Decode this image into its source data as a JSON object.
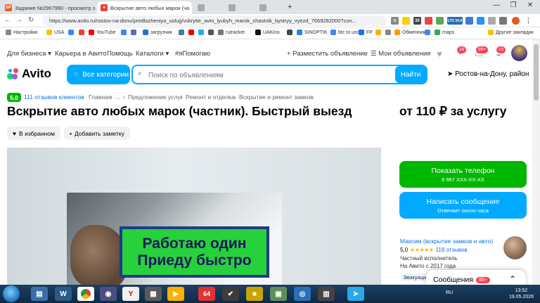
{
  "browser": {
    "tabs": [
      {
        "label": "Задание №2967990 - просмотр з",
        "icon": "sp-icon"
      },
      {
        "label": "Вскрытие авто любых марок (ча",
        "icon": "avito-icon"
      },
      {
        "label": "",
        "icon": "tab-icon"
      },
      {
        "label": "",
        "icon": "tab-icon"
      },
      {
        "label": "",
        "icon": "tab-icon"
      }
    ],
    "url": "https://www.avito.ru/rostov-na-donu/predlozheniya_uslug/vskrytie_avto_lyubyh_marok_chastnik_bystryy_vyezd_7669282000?con...",
    "bookmarks": [
      "Настройки",
      "USA",
      "YouTube",
      "загрузчик",
      "rutracker",
      "UAKino",
      "SINOPTIK",
      "btc to usd",
      "FP",
      "Обменник",
      "maps",
      "Другие закладки"
    ],
    "badges": {
      "ext1": "30",
      "ltc": "LTC 54.0"
    }
  },
  "header": {
    "links": [
      "Для бизнеса",
      "Карьера в Авито",
      "Помощь",
      "Каталоги",
      "#яПомогаю"
    ],
    "post_ad": "+ Разместить объявление",
    "my_ads": "Мои объявления",
    "badges": [
      "16",
      "99+",
      "16"
    ],
    "logo": "Avito",
    "categories_button": "Все категории",
    "search_placeholder": "Поиск по объявлениям",
    "search_button": "Найти",
    "location": "Ростов-на-Дону, район"
  },
  "listing": {
    "rating": "5,0",
    "reviews_link": "111 отзывов клиентов",
    "breadcrumbs": [
      "Главная",
      "...",
      "Предложение услуг",
      "Ремонт и отделка",
      "Вскрытие и ремонт замков"
    ],
    "title": "Вскрытие авто любых марок (частник). Быстрый выезд",
    "price": "от 110 ₽ за услугу",
    "favorite_label": "В избранном",
    "note_label": "Добавить заметку",
    "photo_sign_lines": [
      "Работаю один",
      "Приеду быстро"
    ]
  },
  "contact": {
    "phone_button": "Показать телефон",
    "phone_masked": "8 967 XXX-XX-XX",
    "message_button": "Написать сообщение",
    "message_sub": "Отвечает около часа"
  },
  "seller": {
    "name": "Максим (вскрытие замков и авто)",
    "rating": "5,0",
    "stars": "★★★★★",
    "reviews": "118 отзывов",
    "type": "Частный исполнитель",
    "since": "На Авито с 2017 года",
    "tag": "Эвакуация"
  },
  "messages_panel": {
    "label": "Сообщения",
    "badge": "99+"
  },
  "taskbar": {
    "lang": "RU",
    "time": "13:52",
    "date": "19.05.2026",
    "app_badge": "64"
  }
}
